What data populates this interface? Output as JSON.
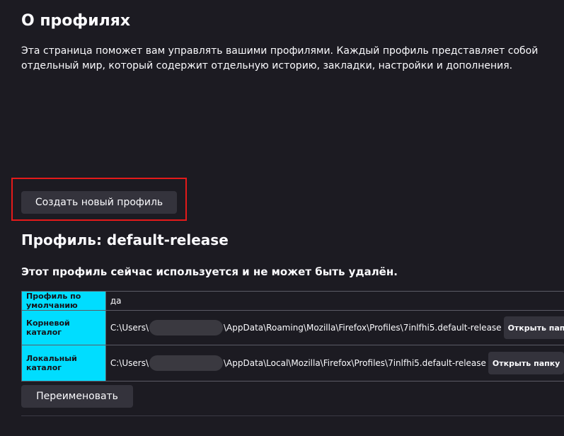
{
  "about": {
    "title": "О профилях",
    "description": "Эта страница поможет вам управлять вашими профилями. Каждый профиль представляет собой отдельный мир, который содержит отдельную историю, закладки, настройки и дополнения."
  },
  "create_button_label": "Создать новый профиль",
  "profile": {
    "heading": "Профиль: default-release",
    "in_use_note": "Этот профиль сейчас используется и не может быть удалён.",
    "rows": {
      "default": {
        "key": "Профиль по умолчанию",
        "value": "да"
      },
      "root": {
        "key": "Корневой каталог",
        "path_prefix": "C:\\Users\\",
        "path_suffix": "\\AppData\\Roaming\\Mozilla\\Firefox\\Profiles\\7inlfhi5.default-release",
        "button": "Открыть папку"
      },
      "local": {
        "key": "Локальный каталог",
        "path_prefix": "C:\\Users\\",
        "path_suffix": "\\AppData\\Local\\Mozilla\\Firefox\\Profiles\\7inlfhi5.default-release",
        "button": "Открыть папку"
      }
    },
    "rename_button_label": "Переименовать"
  },
  "colors": {
    "background": "#1c1b22",
    "key_cell": "#00ddff",
    "highlight": "#e41a1a",
    "button": "#34333c"
  }
}
